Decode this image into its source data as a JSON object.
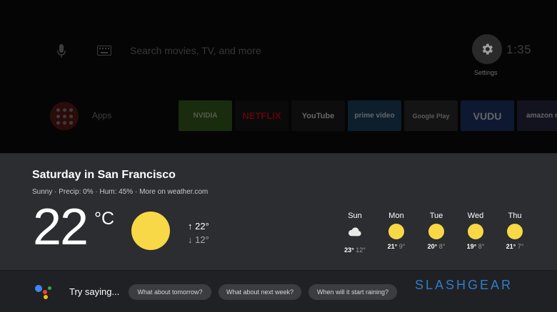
{
  "home": {
    "search_hint": "Search movies, TV, and more",
    "settings_label": "Settings",
    "clock": "1:35",
    "apps_label": "Apps",
    "tiles": [
      {
        "label": "NVIDIA",
        "bg": "#3a6b1d",
        "fg": "#cfe8b5"
      },
      {
        "label": "NETFLIX",
        "bg": "#141414",
        "fg": "#e50914"
      },
      {
        "label": "YouTube",
        "bg": "#1b1b1b",
        "fg": "#ffffff"
      },
      {
        "label": "prime video",
        "bg": "#1a4a6e",
        "fg": "#ffffff"
      },
      {
        "label": "Google Play",
        "bg": "#2e2e2e",
        "fg": "#e0e0e0"
      },
      {
        "label": "VUDU",
        "bg": "#1d3a7a",
        "fg": "#ffffff"
      },
      {
        "label": "amazon m",
        "bg": "#2a2a4e",
        "fg": "#ffffff"
      }
    ]
  },
  "weather": {
    "title": "Saturday in San Francisco",
    "condition": "Sunny",
    "precip": "Precip: 0%",
    "humidity": "Hum: 45%",
    "more_link": "More on weather.com",
    "current_temp": "22",
    "unit": "°C",
    "high": "↑ 22°",
    "low": "↓ 12°",
    "icon": "sun-icon",
    "forecast": [
      {
        "day": "Sun",
        "icon": "cloud-icon",
        "hi": "23°",
        "lo": "12°"
      },
      {
        "day": "Mon",
        "icon": "sun-icon",
        "hi": "21°",
        "lo": "9°"
      },
      {
        "day": "Tue",
        "icon": "sun-icon",
        "hi": "20°",
        "lo": "8°"
      },
      {
        "day": "Wed",
        "icon": "sun-icon",
        "hi": "19°",
        "lo": "8°"
      },
      {
        "day": "Thu",
        "icon": "sun-icon",
        "hi": "21°",
        "lo": "7°"
      }
    ]
  },
  "assistant": {
    "try_saying": "Try saying...",
    "chips": [
      "What about tomorrow?",
      "What about next week?",
      "When will it start raining?"
    ],
    "watermark": "SLASHGEAR"
  },
  "colors": {
    "sun": "#f8d846",
    "card_bg": "#2b2d31",
    "assistant_bg": "#202124",
    "chip_bg": "#3c3d41",
    "ga_blue": "#4285f4",
    "ga_red": "#ea4335",
    "ga_yellow": "#fbbc05",
    "ga_green": "#34a853"
  }
}
